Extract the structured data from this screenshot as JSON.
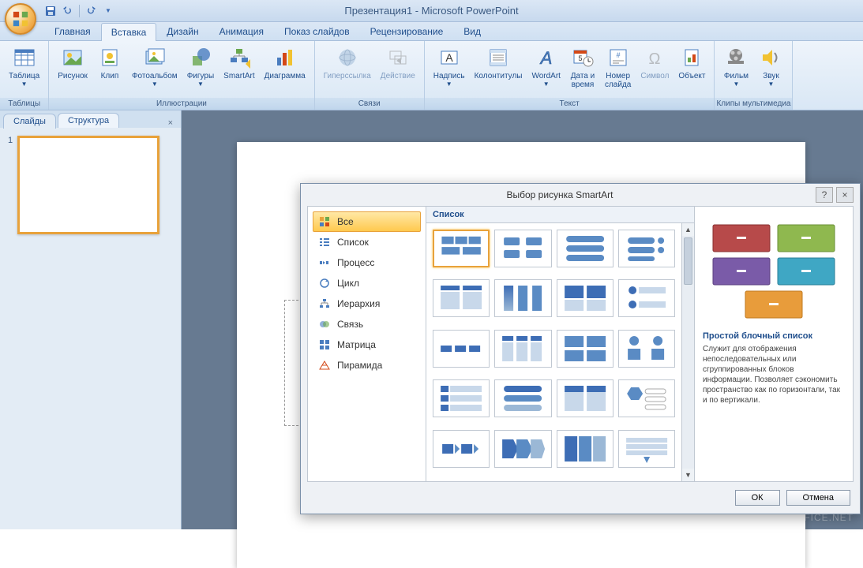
{
  "window": {
    "title": "Презентация1 - Microsoft PowerPoint"
  },
  "qat": {
    "save": "💾",
    "undo": "↶",
    "redo": "↷"
  },
  "ribbon_tabs": [
    "Главная",
    "Вставка",
    "Дизайн",
    "Анимация",
    "Показ слайдов",
    "Рецензирование",
    "Вид"
  ],
  "ribbon": {
    "tables": {
      "label": "Таблицы",
      "table": "Таблица"
    },
    "illustrations": {
      "label": "Иллюстрации",
      "picture": "Рисунок",
      "clip": "Клип",
      "album": "Фотоальбом",
      "shapes": "Фигуры",
      "smartart": "SmartArt",
      "chart": "Диаграмма"
    },
    "links": {
      "label": "Связи",
      "hyperlink": "Гиперссылка",
      "action": "Действие"
    },
    "text": {
      "label": "Текст",
      "textbox": "Надпись",
      "headerfooter": "Колонтитулы",
      "wordart": "WordArt",
      "datetime": "Дата и\nвремя",
      "slidenum": "Номер\nслайда",
      "symbol": "Символ",
      "object": "Объект"
    },
    "media": {
      "label": "Клипы мультимедиа",
      "movie": "Фильм",
      "sound": "Звук"
    }
  },
  "slides_panel": {
    "slides": "Слайды",
    "outline": "Структура",
    "num1": "1"
  },
  "dialog": {
    "title": "Выбор рисунка SmartArt",
    "help": "?",
    "close": "×",
    "categories": [
      "Все",
      "Список",
      "Процесс",
      "Цикл",
      "Иерархия",
      "Связь",
      "Матрица",
      "Пирамида"
    ],
    "gallery_header": "Список",
    "preview_title": "Простой блочный список",
    "preview_desc": "Служит для отображения непоследовательных или сгруппированных блоков информации. Позволяет сэкономить пространство как по горизонтали, так и по вертикали.",
    "ok": "ОК",
    "cancel": "Отмена"
  },
  "watermark": "FREE-OFFICE.NET"
}
